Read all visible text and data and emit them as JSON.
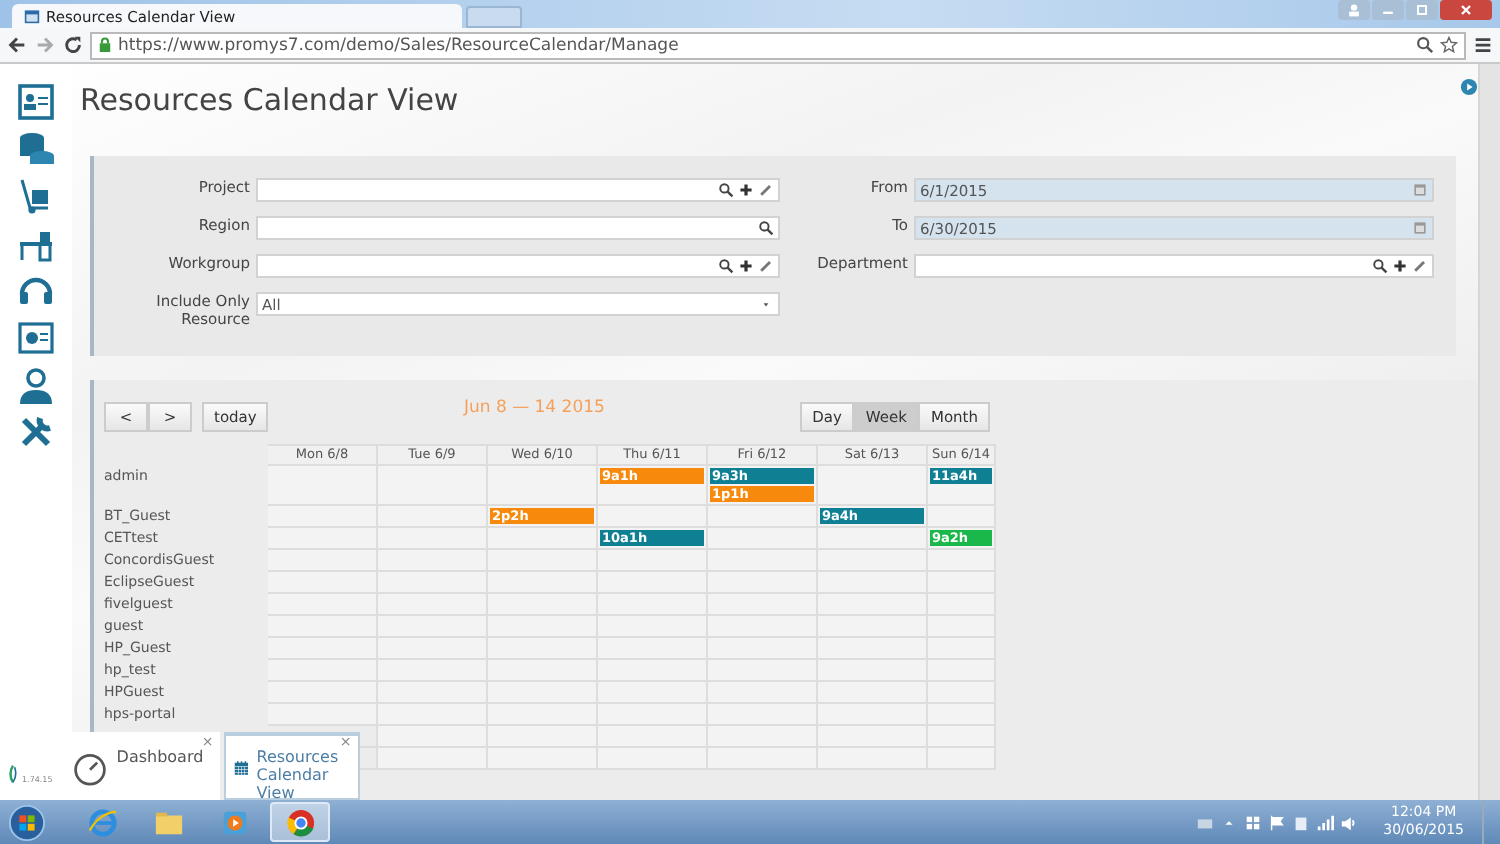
{
  "browser": {
    "tab_title": "Resources Calendar View",
    "url": "https://www.promys7.com/demo/Sales/ResourceCalendar/Manage"
  },
  "page": {
    "title": "Resources Calendar View"
  },
  "filters": {
    "left": [
      {
        "label": "Project",
        "kind": "lookup"
      },
      {
        "label": "Region",
        "kind": "search"
      },
      {
        "label": "Workgroup",
        "kind": "lookup"
      },
      {
        "label": "Include Only Resource",
        "kind": "select",
        "value": "All"
      }
    ],
    "right": [
      {
        "label": "From",
        "kind": "date",
        "value": "6/1/2015"
      },
      {
        "label": "To",
        "kind": "date",
        "value": "6/30/2015"
      },
      {
        "label": "Department",
        "kind": "lookup"
      }
    ]
  },
  "calendar": {
    "prev": "<",
    "next": ">",
    "today": "today",
    "range_title": "Jun 8 — 14 2015",
    "views": [
      {
        "label": "Day",
        "selected": false
      },
      {
        "label": "Week",
        "selected": true
      },
      {
        "label": "Month",
        "selected": false
      }
    ],
    "days": [
      "Mon 6/8",
      "Tue 6/9",
      "Wed 6/10",
      "Thu 6/11",
      "Fri 6/12",
      "Sat 6/13",
      "Sun 6/14"
    ],
    "resources": [
      {
        "name": "admin",
        "cells": [
          null,
          null,
          null,
          [
            {
              "label": "9a1h",
              "color": "#f7890c"
            }
          ],
          [
            {
              "label": "9a3h",
              "color": "#0f7f94"
            },
            {
              "label": "1p1h",
              "color": "#f7890c"
            }
          ],
          null,
          [
            {
              "label": "11a4h",
              "color": "#0f7f94"
            }
          ]
        ]
      },
      {
        "name": "BT_Guest",
        "cells": [
          null,
          null,
          [
            {
              "label": "2p2h",
              "color": "#f7890c"
            }
          ],
          null,
          null,
          [
            {
              "label": "9a4h",
              "color": "#0f7f94"
            }
          ],
          null
        ]
      },
      {
        "name": "CETtest",
        "cells": [
          null,
          null,
          null,
          [
            {
              "label": "10a1h",
              "color": "#0f7f94"
            }
          ],
          null,
          null,
          [
            {
              "label": "9a2h",
              "color": "#1ab84a"
            }
          ]
        ]
      },
      {
        "name": "ConcordisGuest"
      },
      {
        "name": "EclipseGuest"
      },
      {
        "name": "fivelguest"
      },
      {
        "name": "guest"
      },
      {
        "name": "HP_Guest"
      },
      {
        "name": "hp_test"
      },
      {
        "name": "HPGuest"
      },
      {
        "name": "hps-portal"
      }
    ]
  },
  "app_tabs": [
    {
      "label": "Dashboard",
      "kind": "gauge",
      "selected": false,
      "close": "×"
    },
    {
      "label": "Resources Calendar View",
      "kind": "calendar",
      "selected": true,
      "close": "×"
    }
  ],
  "version": "1.74.15",
  "taskbar": {
    "apps": [
      {
        "kind": "ie",
        "selected": false
      },
      {
        "kind": "folder",
        "selected": false
      },
      {
        "kind": "media",
        "selected": false
      },
      {
        "kind": "chrome",
        "selected": true
      }
    ],
    "time": "12:04 PM",
    "date": "30/06/2015"
  }
}
